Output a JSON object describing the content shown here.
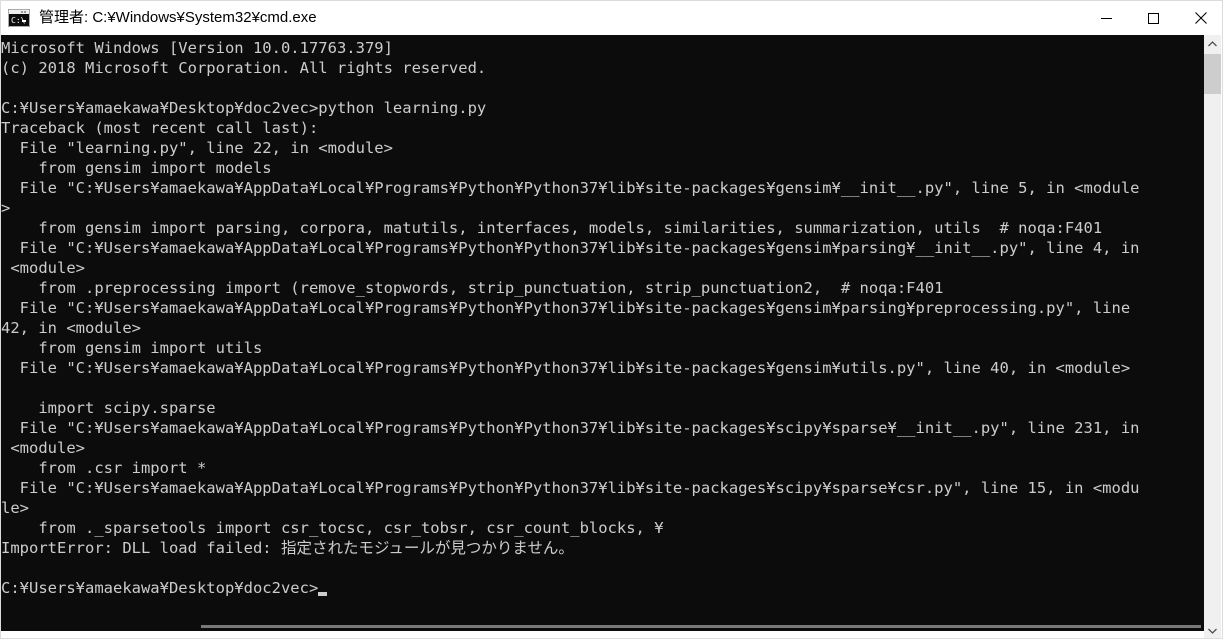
{
  "window": {
    "title": "管理者: C:¥Windows¥System32¥cmd.exe",
    "icon": "cmd-console-icon",
    "controls": {
      "minimize": "—",
      "maximize": "□",
      "close": "✕"
    },
    "titlebar_bg": "#ffffff",
    "console_bg": "#0c0c0c",
    "console_fg": "#cccccc"
  },
  "console": {
    "prompt_path": "C:¥Users¥amaekawa¥Desktop¥doc2vec",
    "command": "python learning.py",
    "cursor_visible": true,
    "lines": [
      "Microsoft Windows [Version 10.0.17763.379]",
      "(c) 2018 Microsoft Corporation. All rights reserved.",
      "",
      "C:¥Users¥amaekawa¥Desktop¥doc2vec>python learning.py",
      "Traceback (most recent call last):",
      "  File \"learning.py\", line 22, in <module>",
      "    from gensim import models",
      "  File \"C:¥Users¥amaekawa¥AppData¥Local¥Programs¥Python¥Python37¥lib¥site-packages¥gensim¥__init__.py\", line 5, in <module>",
      "    from gensim import parsing, corpora, matutils, interfaces, models, similarities, summarization, utils  # noqa:F401",
      "  File \"C:¥Users¥amaekawa¥AppData¥Local¥Programs¥Python¥Python37¥lib¥site-packages¥gensim¥parsing¥__init__.py\", line 4, in <module>",
      "    from .preprocessing import (remove_stopwords, strip_punctuation, strip_punctuation2,  # noqa:F401",
      "  File \"C:¥Users¥amaekawa¥AppData¥Local¥Programs¥Python¥Python37¥lib¥site-packages¥gensim¥parsing¥preprocessing.py\", line 42, in <module>",
      "    from gensim import utils",
      "  File \"C:¥Users¥amaekawa¥AppData¥Local¥Programs¥Python¥Python37¥lib¥site-packages¥gensim¥utils.py\", line 40, in <module>",
      "",
      "    import scipy.sparse",
      "  File \"C:¥Users¥amaekawa¥AppData¥Local¥Programs¥Python¥Python37¥lib¥site-packages¥scipy¥sparse¥__init__.py\", line 231, in <module>",
      "    from .csr import *",
      "  File \"C:¥Users¥amaekawa¥AppData¥Local¥Programs¥Python¥Python37¥lib¥site-packages¥scipy¥sparse¥csr.py\", line 15, in <module>",
      "    from ._sparsetools import csr_tocsc, csr_tobsr, csr_count_blocks, ¥",
      "ImportError: DLL load failed: 指定されたモジュールが見つかりません。",
      "",
      "C:¥Users¥amaekawa¥Desktop¥doc2vec>"
    ],
    "error": {
      "type": "ImportError",
      "message": "DLL load failed: 指定されたモジュールが見つかりません。"
    }
  },
  "scrollbars": {
    "vertical": {
      "up_arrow": "scroll-up-icon",
      "down_arrow": "scroll-down-icon",
      "thumb_color": "#cdcdcd",
      "track_color": "#f0f0f0"
    },
    "horizontal": {
      "thumb_color": "#787878"
    }
  }
}
